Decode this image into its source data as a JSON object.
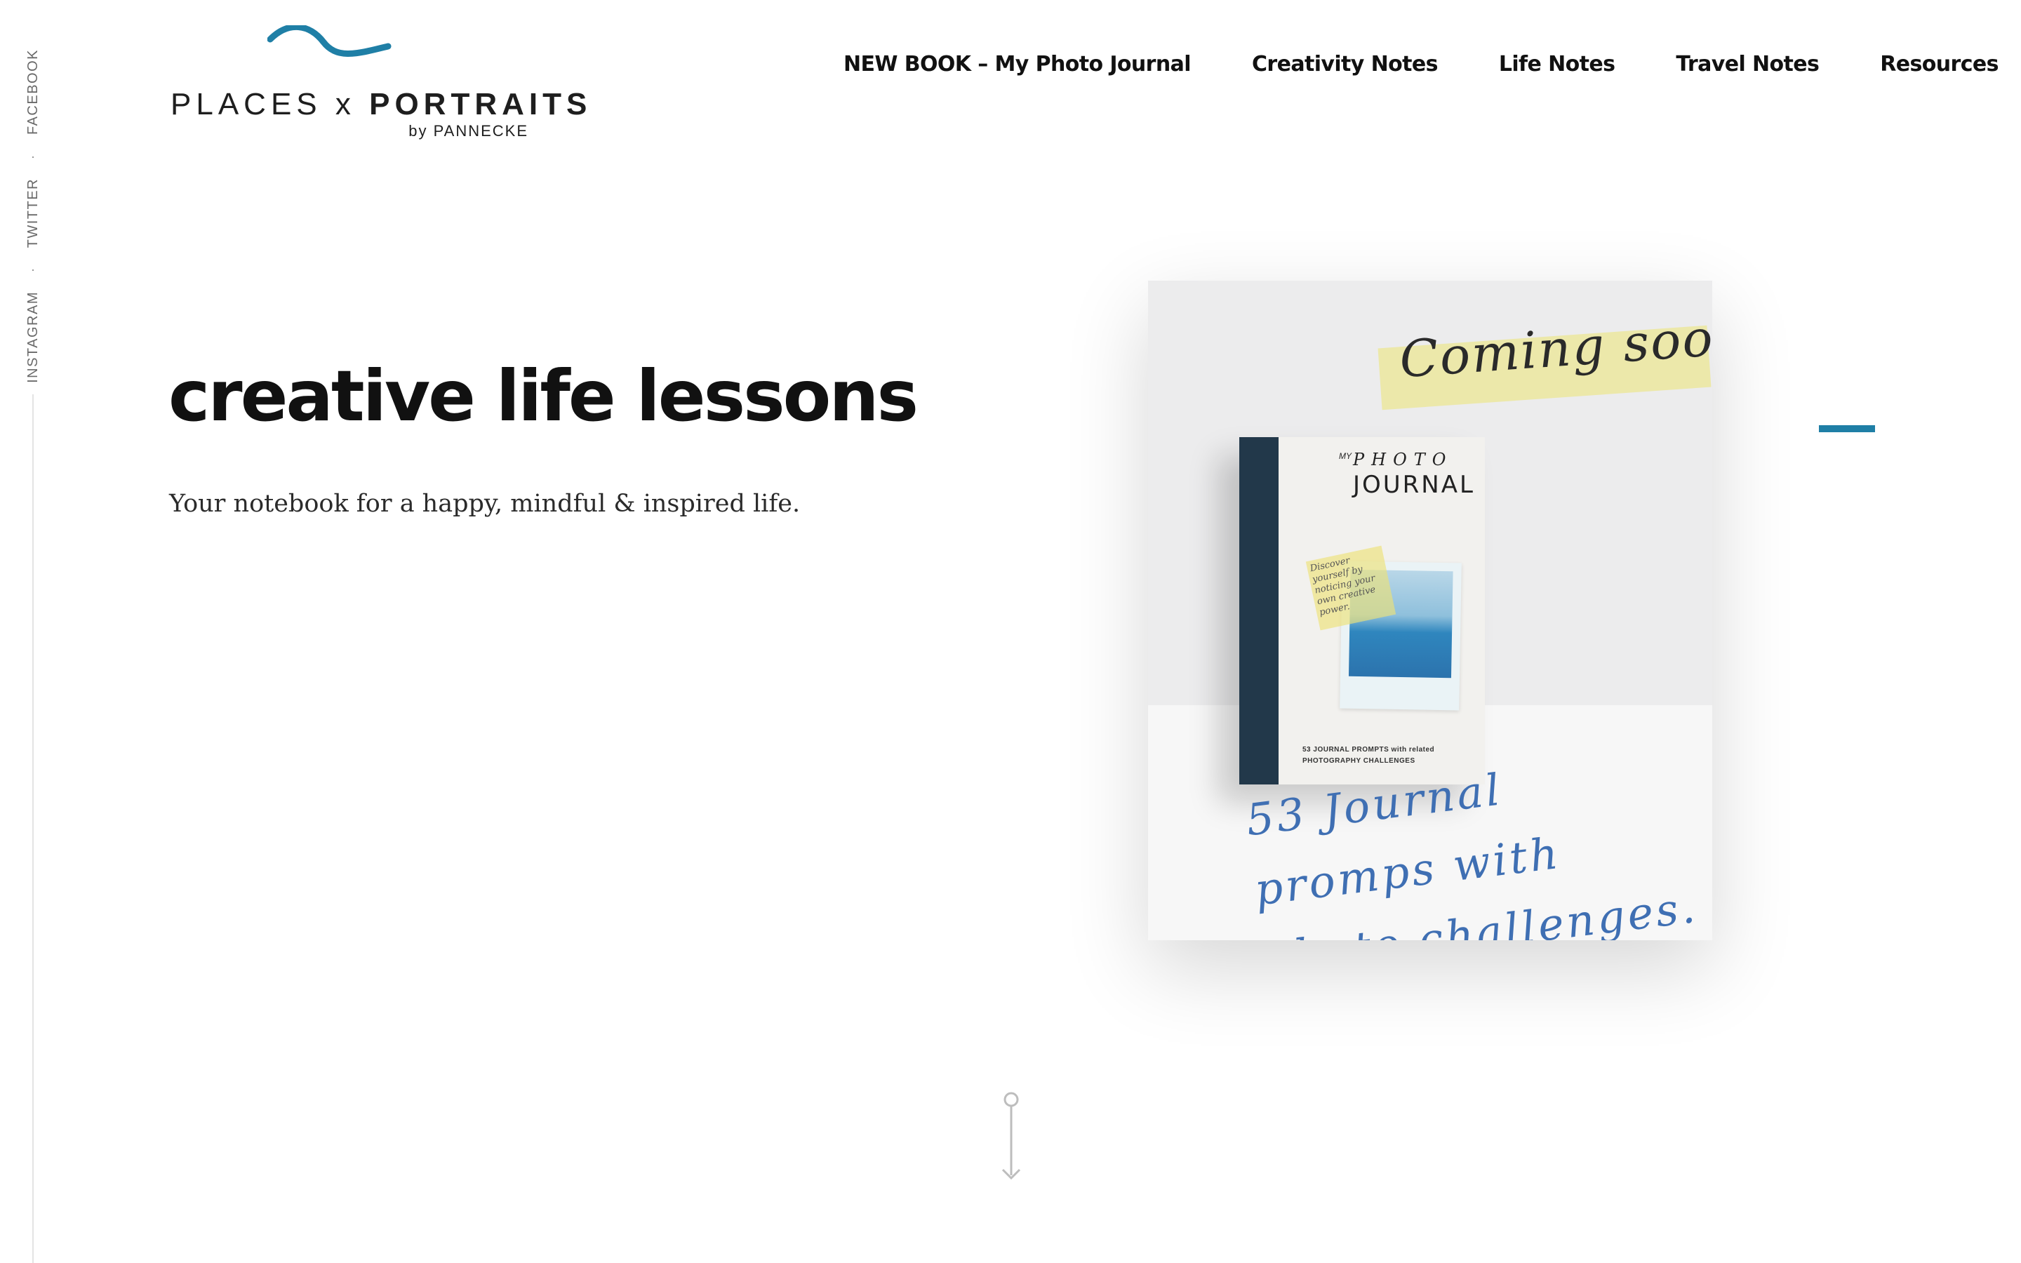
{
  "social": {
    "links": [
      "Facebook",
      "Twitter",
      "Instagram"
    ],
    "separator": "·"
  },
  "logo": {
    "part1": "PLACES x ",
    "part2": "PORTRAITS",
    "byline": "by PANNECKE",
    "accent_color": "#1f7fa6"
  },
  "nav": {
    "items": [
      "NEW BOOK – My Photo Journal",
      "Creativity Notes",
      "Life Notes",
      "Travel Notes",
      "Resources"
    ]
  },
  "hero": {
    "title": "creative life lessons",
    "subtitle": "Your notebook for a happy, mindful & inspired life."
  },
  "promo": {
    "banner": "Coming soon!",
    "book_my": "MY",
    "book_photo": "PHOTO",
    "book_journal": "JOURNAL",
    "book_note": "Discover yourself by noticing your own creative power.",
    "book_footer1": "53 JOURNAL PROMPTS with related",
    "book_footer2": "PHOTOGRAPHY CHALLENGES",
    "script_line1": "53 Journal promps with",
    "script_line2": "photo challenges."
  },
  "icons": {
    "wave": "wave-logo-icon",
    "scroll": "scroll-down-icon"
  },
  "colors": {
    "accent": "#1f7fa6",
    "text": "#111111",
    "sticky": "#ece8a6"
  }
}
